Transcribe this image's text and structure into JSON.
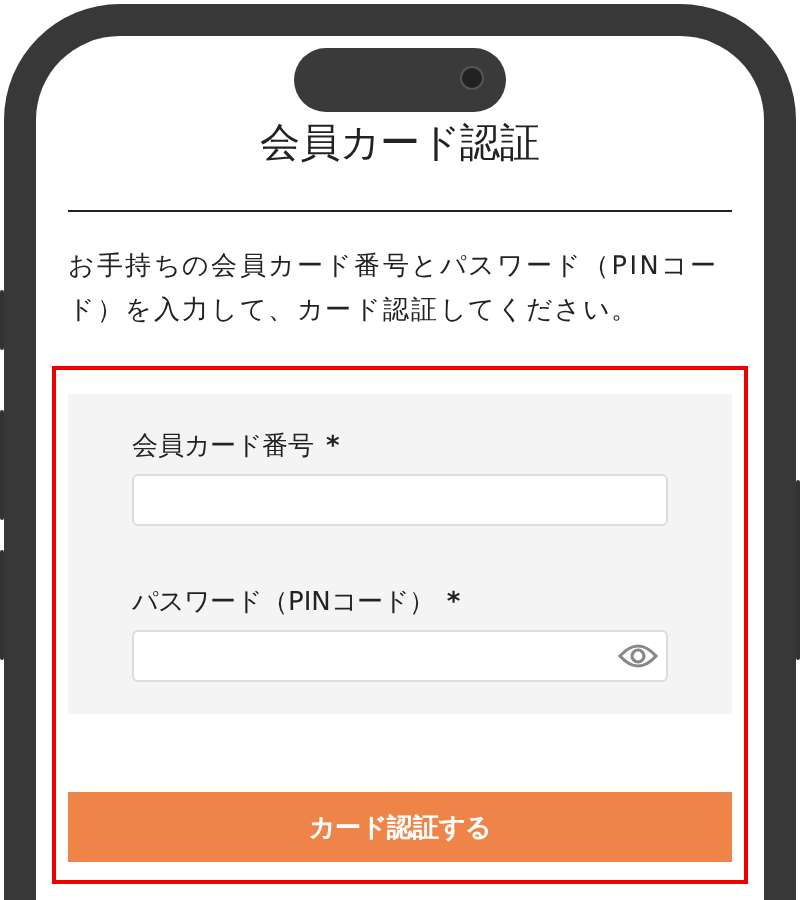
{
  "title": "会員カード認証",
  "description": "お手持ちの会員カード番号とパスワード（PINコード）を入力して、カード認証してください。",
  "form": {
    "fields": [
      {
        "label": "会員カード番号",
        "required_mark": "*",
        "kind": "text"
      },
      {
        "label": "パスワード（PINコード）",
        "required_mark": "*",
        "kind": "password"
      }
    ],
    "submit": "カード認証する"
  }
}
